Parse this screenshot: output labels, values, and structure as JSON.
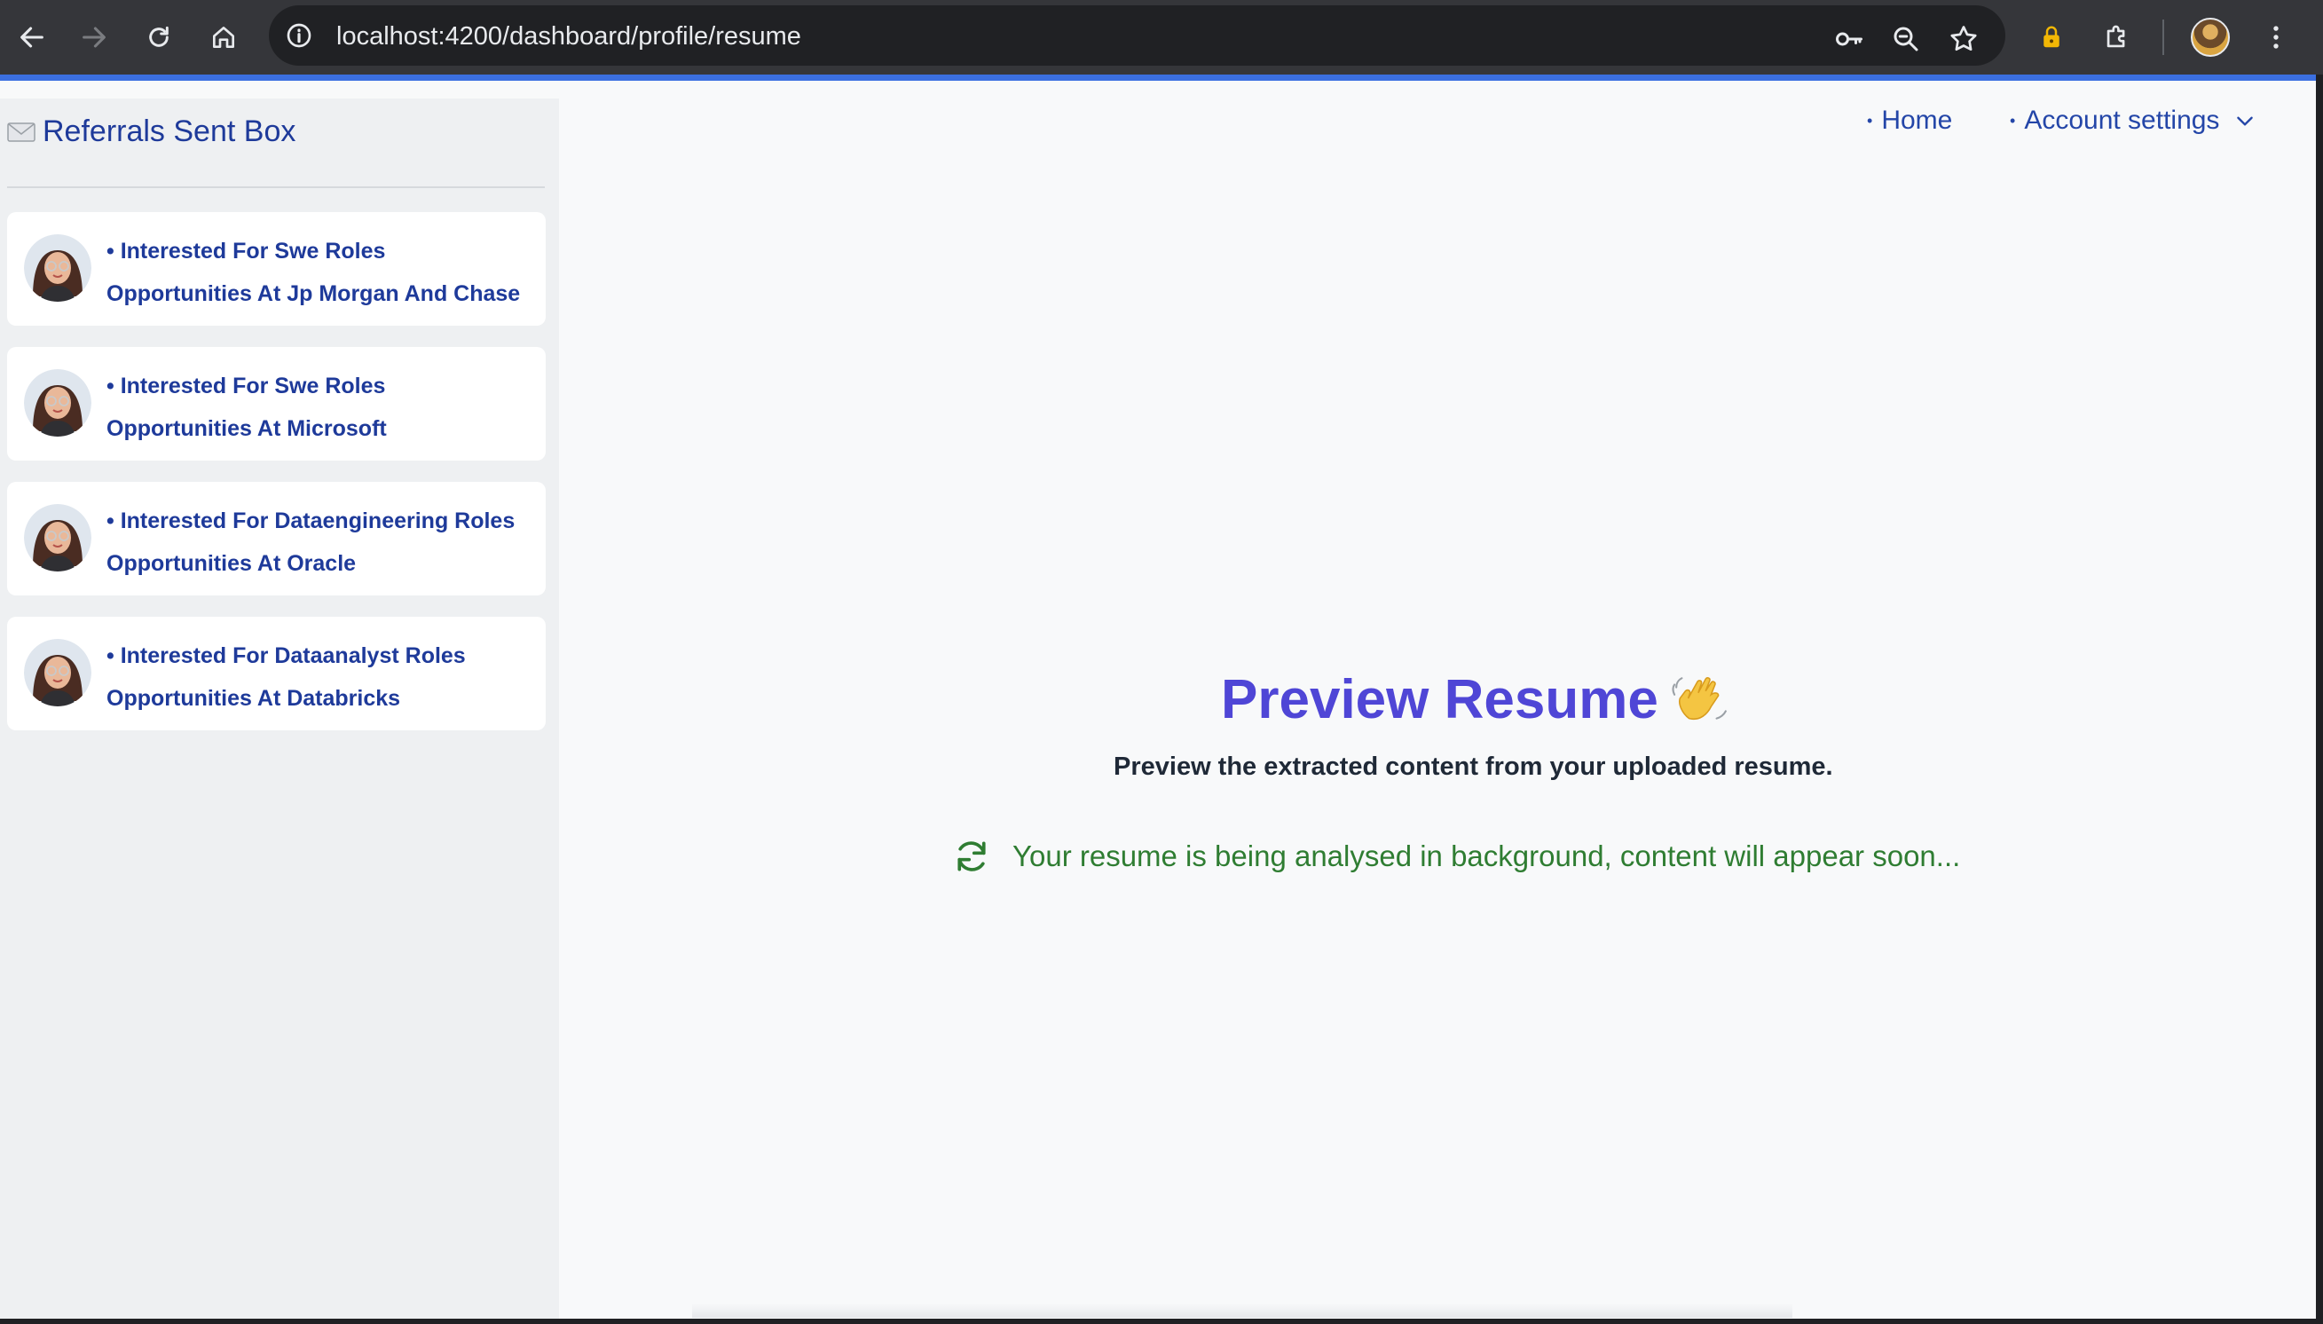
{
  "browser": {
    "url": "localhost:4200/dashboard/profile/resume",
    "icons": [
      "back-icon",
      "forward-icon",
      "reload-icon",
      "home-icon",
      "site-info-icon",
      "password-key-icon",
      "zoom-icon",
      "bookmark-star-icon",
      "extension-lock-icon",
      "extensions-puzzle-icon",
      "profile-avatar",
      "more-menu-icon"
    ]
  },
  "sidebar": {
    "title_icon": "envelope-icon",
    "title": "Referrals Sent Box",
    "items": [
      {
        "label": "• Interested For Swe Roles Opportunities At Jp Morgan And Chase"
      },
      {
        "label": "• Interested For Swe Roles Opportunities At Microsoft"
      },
      {
        "label": "• Interested For Dataengineering Roles Opportunities At Oracle"
      },
      {
        "label": "• Interested For Dataanalyst Roles Opportunities At Databricks"
      }
    ]
  },
  "nav": {
    "home": "Home",
    "account_settings": "Account settings",
    "bullet": "•"
  },
  "main": {
    "title": "Preview Resume",
    "title_emoji_icon": "waving-hand-icon",
    "subtitle": "Preview the extracted content from your uploaded resume.",
    "status": "Your resume is being analysed in background, content will appear soon...",
    "status_icon": "refresh-icon"
  },
  "colors": {
    "accent_blue": "#3b6fe0",
    "link_blue": "#1e3a9a",
    "title_indigo": "#4f46d6",
    "status_green": "#2f7d32"
  }
}
